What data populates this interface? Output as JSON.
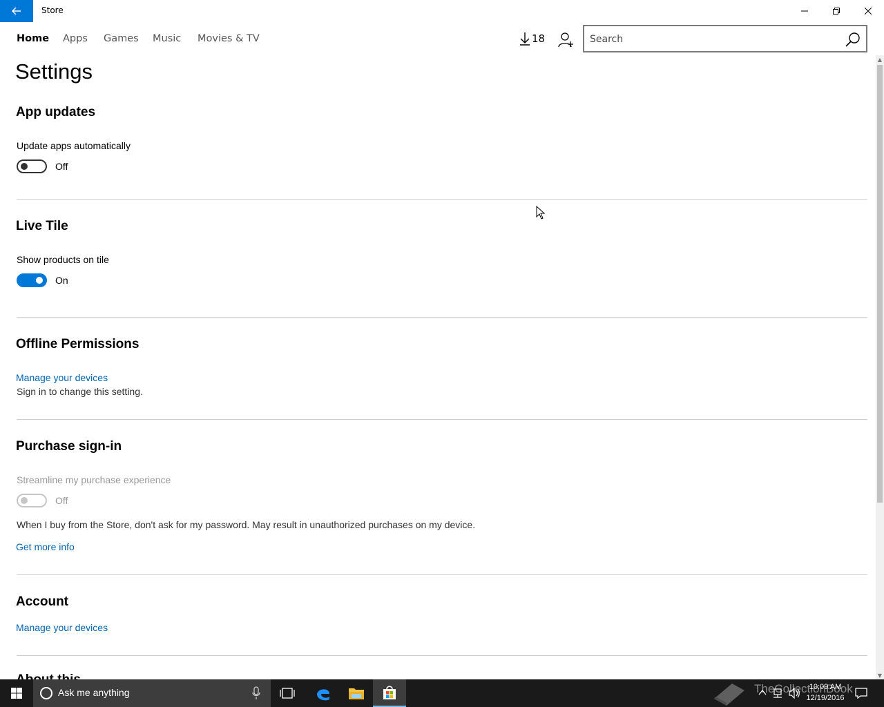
{
  "window": {
    "title": "Store",
    "accent": "#0078d7"
  },
  "nav": {
    "tabs": [
      {
        "label": "Home",
        "active": true
      },
      {
        "label": "Apps"
      },
      {
        "label": "Games"
      },
      {
        "label": "Music"
      },
      {
        "label": "Movies & TV"
      }
    ],
    "downloads_count": "18",
    "search_placeholder": "Search"
  },
  "page": {
    "title": "Settings",
    "sections": {
      "app_updates": {
        "title": "App updates",
        "label": "Update apps automatically",
        "state": "Off"
      },
      "live_tile": {
        "title": "Live Tile",
        "label": "Show products on tile",
        "state": "On"
      },
      "offline": {
        "title": "Offline Permissions",
        "link": "Manage your devices",
        "note": "Sign in to change this setting."
      },
      "purchase": {
        "title": "Purchase sign-in",
        "label": "Streamline my purchase experience",
        "state": "Off",
        "description": "When I buy from the Store, don't ask for my password. May result in unauthorized purchases on my device.",
        "link": "Get more info"
      },
      "account": {
        "title": "Account",
        "link": "Manage your devices"
      },
      "about": {
        "title": "About this"
      }
    }
  },
  "taskbar": {
    "search_text": "Ask me anything",
    "time": "10:09 AM",
    "date": "12/19/2016"
  },
  "watermark": "TheCollectionBook"
}
